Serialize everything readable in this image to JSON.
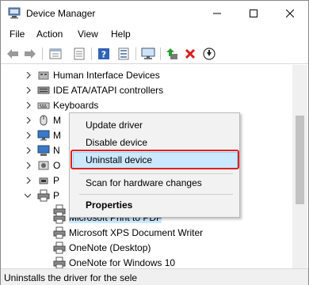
{
  "window": {
    "title": "Device Manager"
  },
  "menubar": {
    "items": [
      "File",
      "Action",
      "View",
      "Help"
    ]
  },
  "toolbar": {
    "buttons": [
      "back-icon",
      "forward-icon",
      "properties-list-icon",
      "device-list-icon",
      "help-icon",
      "resource-icon",
      "monitor-icon",
      "update-driver-icon",
      "uninstall-icon",
      "scan-download-icon"
    ]
  },
  "tree": {
    "rows": [
      {
        "label": "Human Interface Devices",
        "icon": "hid-icon"
      },
      {
        "label": "IDE ATA/ATAPI controllers",
        "icon": "ide-icon"
      },
      {
        "label": "Keyboards",
        "icon": "keyboard-icon"
      },
      {
        "label": "M",
        "icon": "mouse-icon"
      },
      {
        "label": "M",
        "icon": "monitor-icon"
      },
      {
        "label": "N",
        "icon": "network-icon"
      },
      {
        "label": "O",
        "icon": "other-icon"
      },
      {
        "label": "P",
        "icon": "ports-icon"
      },
      {
        "label": "P",
        "icon": "printer-icon"
      },
      {
        "label": "",
        "icon": "printer-icon"
      },
      {
        "label": "Microsoft Print to PDF",
        "icon": "printer-icon"
      },
      {
        "label": "Microsoft XPS Document Writer",
        "icon": "printer-icon"
      },
      {
        "label": "OneNote (Desktop)",
        "icon": "printer-icon"
      },
      {
        "label": "OneNote for Windows 10",
        "icon": "printer-icon"
      }
    ]
  },
  "context_menu": {
    "update_driver": "Update driver",
    "disable_device": "Disable device",
    "uninstall_device": "Uninstall device",
    "scan_changes": "Scan for hardware changes",
    "properties": "Properties"
  },
  "status": {
    "text": "Uninstalls the driver for the sele"
  },
  "colors": {
    "highlight": "#cce8ff",
    "annotation_red": "#e02020",
    "delete_red": "#d81e1e",
    "green_arrow": "#2e9b2e"
  }
}
